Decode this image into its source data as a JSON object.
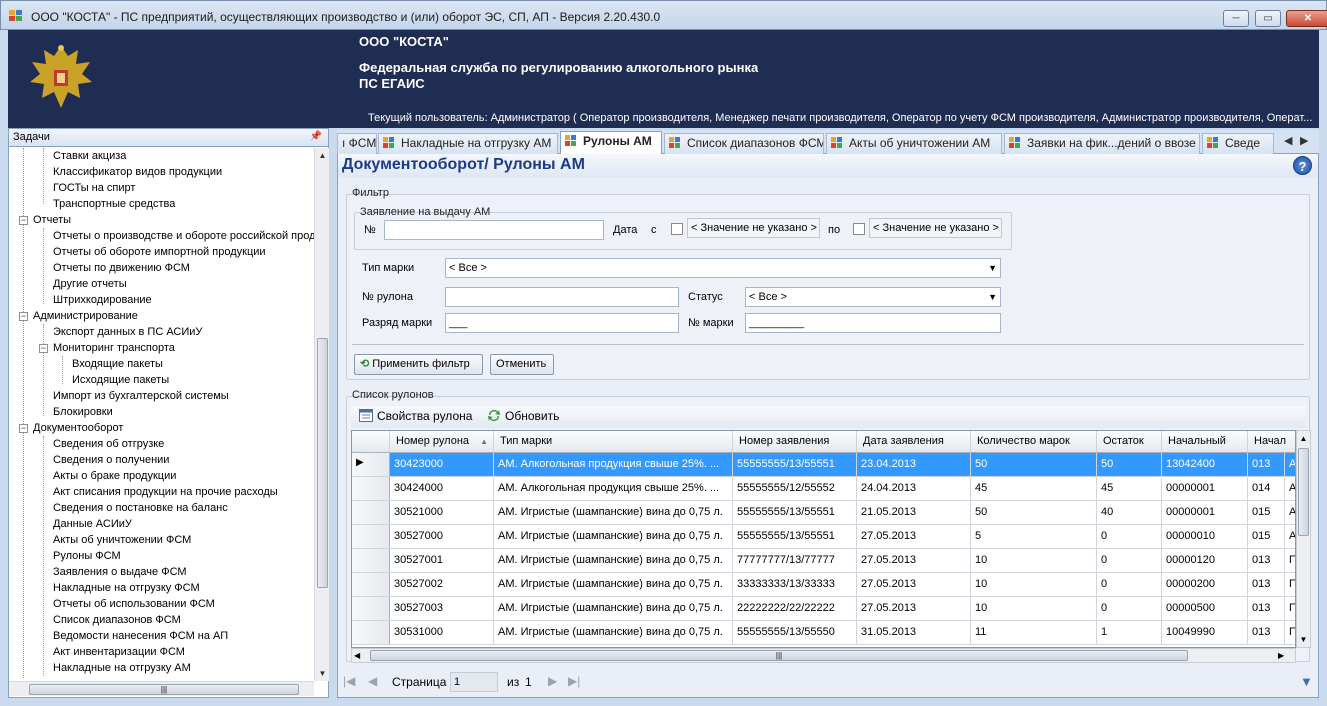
{
  "window": {
    "title": "ООО \"КОСТА\" - ПС предприятий, осуществляющих производство и (или) оборот ЭС, СП, АП - Версия 2.20.430.0",
    "minimize": "─",
    "maximize": "▭",
    "close": "✕"
  },
  "header": {
    "org": "ООО \"КОСТА\"",
    "service_line1": "Федеральная служба по регулированию алкогольного рынка",
    "service_line2": "ПС ЕГАИС",
    "user": "Текущий пользователь: Администратор ( Оператор производителя, Менеджер печати производителя, Оператор по учету ФСМ производителя, Администратор производителя, Операт..."
  },
  "left_panel": {
    "title": "Задачи",
    "pin": "ᵖ",
    "items": [
      {
        "label": "Ставки акциза"
      },
      {
        "label": "Классификатор видов продукции"
      },
      {
        "label": "ГОСТы на спирт"
      },
      {
        "label": "Транспортные средства"
      },
      {
        "label": "Отчеты"
      },
      {
        "label": "Отчеты о производстве и обороте российской прод"
      },
      {
        "label": "Отчеты об обороте импортной продукции"
      },
      {
        "label": "Отчеты по движению ФСМ"
      },
      {
        "label": "Другие отчеты"
      },
      {
        "label": "Штрихкодирование"
      },
      {
        "label": "Администрирование"
      },
      {
        "label": "Экспорт данных в ПС АСИиУ"
      },
      {
        "label": "Мониторинг транспорта"
      },
      {
        "label": "Входящие пакеты"
      },
      {
        "label": "Исходящие пакеты"
      },
      {
        "label": "Импорт из бухгалтерской системы"
      },
      {
        "label": "Блокировки"
      },
      {
        "label": "Документооборот"
      },
      {
        "label": "Сведения об отгрузке"
      },
      {
        "label": "Сведения о получении"
      },
      {
        "label": "Акты о браке продукции"
      },
      {
        "label": "Акт списания продукции на прочие расходы"
      },
      {
        "label": "Сведения о постановке на баланс"
      },
      {
        "label": "Данные АСИиУ"
      },
      {
        "label": "Акты об уничтожении ФСМ"
      },
      {
        "label": "Рулоны ФСМ"
      },
      {
        "label": "Заявления о выдаче ФСМ"
      },
      {
        "label": "Накладные на отгрузку ФСМ"
      },
      {
        "label": "Отчеты об использовании ФСМ"
      },
      {
        "label": "Список диапазонов ФСМ"
      },
      {
        "label": "Ведомости нанесения ФСМ на АП"
      },
      {
        "label": "Акт инвентаризации ФСМ"
      },
      {
        "label": "Накладные на отгрузку АМ"
      }
    ]
  },
  "tabs": [
    {
      "label": "ı ФСМ"
    },
    {
      "label": "Накладные на отгрузку АМ"
    },
    {
      "label": "Рулоны АМ"
    },
    {
      "label": "Список диапазонов ФСМ"
    },
    {
      "label": "Акты об уничтожении АМ"
    },
    {
      "label": "Заявки на фик...дений о ввозе"
    },
    {
      "label": "Сведе"
    }
  ],
  "tab_nav": {
    "prev": "◀",
    "next": "▶"
  },
  "content": {
    "title": "Документооборот/ Рулоны АМ",
    "help": "?",
    "filter": {
      "group_label": "Фильтр",
      "request_group_label": "Заявление на выдачу АМ",
      "number_label": "№",
      "number_value": "",
      "date_label": "Дата",
      "from_label": "с",
      "date_from": "< Значение не указано >",
      "to_label": "по",
      "date_to": "< Значение не указано >",
      "mark_type_label": "Тип марки",
      "mark_type_value": "< Все >",
      "roll_number_label": "№ рулона",
      "roll_number_value": "",
      "status_label": "Статус",
      "status_value": "< Все >",
      "mark_rank_label": "Разряд марки",
      "mark_rank_value": "___",
      "mark_number_label": "№ марки",
      "mark_number_value": "_________",
      "apply_button": "Применить фильтр",
      "cancel_button": "Отменить"
    },
    "list": {
      "group_label": "Список рулонов",
      "toolbar": {
        "properties": "Свойства рулона",
        "refresh": "Обновить"
      },
      "columns": [
        "Номер рулона",
        "Тип марки",
        "Номер заявления",
        "Дата заявления",
        "Количество марок",
        "Остаток",
        "Начальный",
        "Начал"
      ],
      "rows": [
        [
          "30423000",
          "АМ. Алкогольная продукция свыше 25%. ...",
          "55555555/13/55551",
          "23.04.2013",
          "50",
          "50",
          "13042400",
          "013",
          "А"
        ],
        [
          "30424000",
          "АМ. Алкогольная продукция свыше 25%. ...",
          "55555555/12/55552",
          "24.04.2013",
          "45",
          "45",
          "00000001",
          "014",
          "А"
        ],
        [
          "30521000",
          "АМ. Игристые (шампанские) вина до 0,75 л.",
          "55555555/13/55551",
          "21.05.2013",
          "50",
          "40",
          "00000001",
          "015",
          "А"
        ],
        [
          "30527000",
          "АМ. Игристые (шампанские) вина до 0,75 л.",
          "55555555/13/55551",
          "27.05.2013",
          "5",
          "0",
          "00000010",
          "015",
          "А"
        ],
        [
          "30527001",
          "АМ. Игристые (шампанские) вина до 0,75 л.",
          "77777777/13/77777",
          "27.05.2013",
          "10",
          "0",
          "00000120",
          "013",
          "П"
        ],
        [
          "30527002",
          "АМ. Игристые (шампанские) вина до 0,75 л.",
          "33333333/13/33333",
          "27.05.2013",
          "10",
          "0",
          "00000200",
          "013",
          "П"
        ],
        [
          "30527003",
          "АМ. Игристые (шампанские) вина до 0,75 л.",
          "22222222/22/22222",
          "27.05.2013",
          "10",
          "0",
          "00000500",
          "013",
          "П"
        ],
        [
          "30531000",
          "АМ. Игристые (шампанские) вина до 0,75 л.",
          "55555555/13/55550",
          "31.05.2013",
          "11",
          "1",
          "10049990",
          "013",
          "П"
        ]
      ],
      "sort_indicator": "▲",
      "current_row_marker": "▶"
    },
    "pager": {
      "page_label": "Страница",
      "page_value": "1",
      "of_label": "из",
      "total": "1",
      "first": "|◀",
      "prev": "◀",
      "next": "▶",
      "last": "▶|"
    },
    "filter_icon": "▼"
  },
  "colors": {
    "banner": "#1f2d52",
    "selection": "#3399ff",
    "title_blue": "#1a3a8a"
  }
}
